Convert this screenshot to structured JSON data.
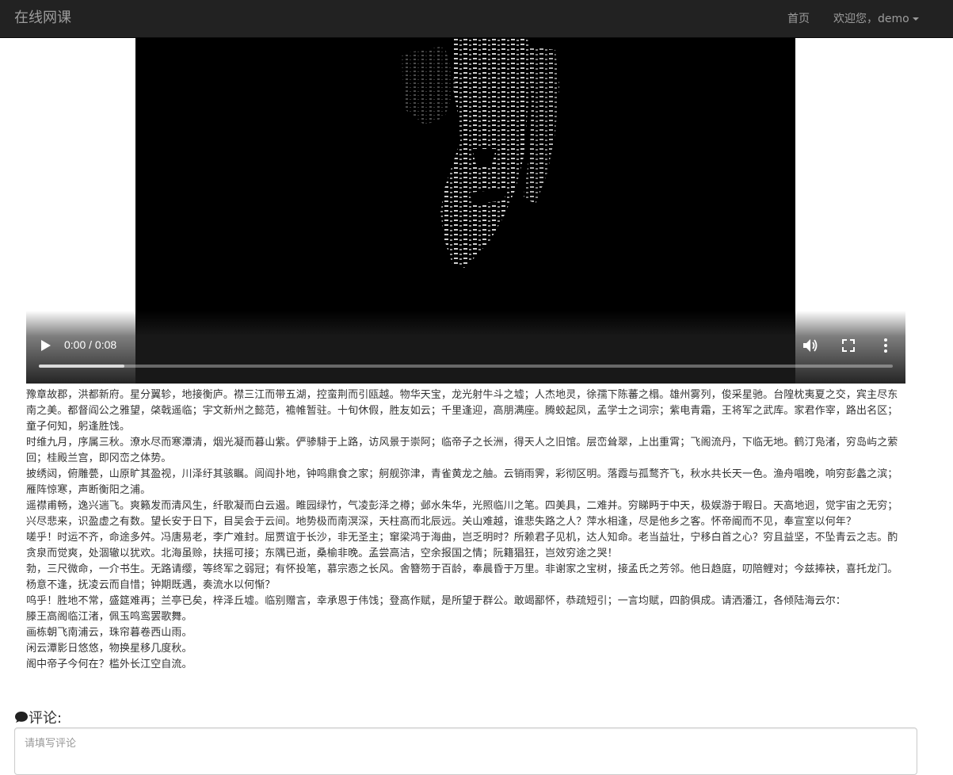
{
  "navbar": {
    "brand": "在线网课",
    "home_label": "首页",
    "user_label": "欢迎您，demo"
  },
  "video": {
    "time_display": "0:00 / 0:08",
    "buffered_fraction": 0.1,
    "icons": [
      "play-icon",
      "volume-icon",
      "fullscreen-icon",
      "more-options-icon"
    ]
  },
  "essay": {
    "paragraphs": [
      "豫章故郡，洪都新府。星分翼轸，地接衡庐。襟三江而带五湖，控蛮荆而引瓯越。物华天宝，龙光射牛斗之墟；人杰地灵，徐孺下陈蕃之榻。雄州雾列，俊采星驰。台隍枕夷夏之交，宾主尽东南之美。都督阎公之雅望，棨戟遥临；宇文新州之懿范，襜帷暂驻。十旬休假，胜友如云；千里逢迎，高朋满座。腾蛟起凤，孟学士之词宗；紫电青霜，王将军之武库。家君作宰，路出名区；童子何知，躬逢胜饯。",
      "时维九月，序属三秋。潦水尽而寒潭清，烟光凝而暮山紫。俨骖騑于上路，访风景于崇阿；临帝子之长洲，得天人之旧馆。层峦耸翠，上出重霄；飞阁流丹，下临无地。鹤汀凫渚，穷岛屿之萦回；桂殿兰宫，即冈峦之体势。",
      "披绣闼，俯雕甍，山原旷其盈视，川泽纡其骇瞩。闾阎扑地，钟鸣鼎食之家；舸舰弥津，青雀黄龙之舳。云销雨霁，彩彻区明。落霞与孤鹜齐飞，秋水共长天一色。渔舟唱晚，响穷彭蠡之滨；雁阵惊寒，声断衡阳之浦。",
      "遥襟甫畅，逸兴遄飞。爽籁发而清风生，纤歌凝而白云遏。睢园绿竹，气凌彭泽之樽；邺水朱华，光照临川之笔。四美具，二难并。穷睇眄于中天，极娱游于暇日。天高地迥，觉宇宙之无穷；兴尽悲来，识盈虚之有数。望长安于日下，目吴会于云间。地势极而南溟深，天柱高而北辰远。关山难越，谁悲失路之人？萍水相逢，尽是他乡之客。怀帝阍而不见，奉宣室以何年？",
      "嗟乎！时运不齐，命途多舛。冯唐易老，李广难封。屈贾谊于长沙，非无圣主；窜梁鸿于海曲，岂乏明时？所赖君子见机，达人知命。老当益壮，宁移白首之心？穷且益坚，不坠青云之志。酌贪泉而觉爽，处涸辙以犹欢。北海虽赊，扶摇可接；东隅已逝，桑榆非晚。孟尝高洁，空余报国之情；阮籍猖狂，岂效穷途之哭！",
      "勃，三尺微命，一介书生。无路请缨，等终军之弱冠；有怀投笔，慕宗悫之长风。舍簪笏于百龄，奉晨昏于万里。非谢家之宝树，接孟氏之芳邻。他日趋庭，叨陪鲤对；今兹捧袂，喜托龙门。杨意不逢，抚凌云而自惜；钟期既遇，奏流水以何惭？",
      "呜乎！胜地不常，盛筵难再；兰亭已矣，梓泽丘墟。临别赠言，幸承恩于伟饯；登高作赋，是所望于群公。敢竭鄙怀，恭疏短引；一言均赋，四韵俱成。请洒潘江，各倾陆海云尔：",
      "滕王高阁临江渚，佩玉鸣鸾罢歌舞。",
      "画栋朝飞南浦云，珠帘暮卷西山雨。",
      "闲云潭影日悠悠，物换星移几度秋。",
      "阁中帝子今何在？槛外长江空自流。"
    ]
  },
  "comments": {
    "title": "评论:",
    "placeholder": "请填写评论",
    "value": ""
  }
}
